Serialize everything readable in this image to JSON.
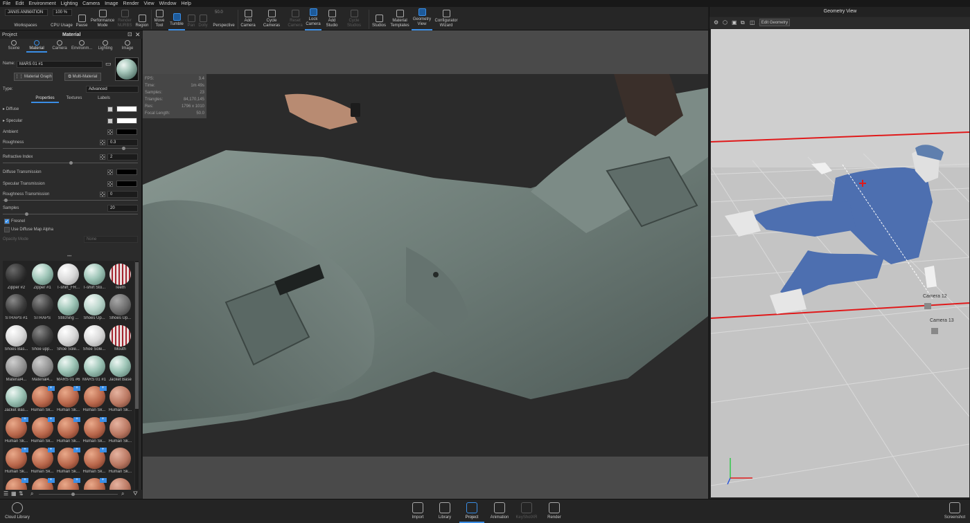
{
  "menu": [
    "File",
    "Edit",
    "Environment",
    "Lighting",
    "Camera",
    "Image",
    "Render",
    "View",
    "Window",
    "Help"
  ],
  "toolbar": {
    "workspace_name": "JANIS ANIMATION",
    "workspaces_label": "Workspaces",
    "cpu_value": "100 %",
    "cpu_label": "CPU Usage",
    "pause_label": "Pause",
    "performance_label": "Performance Mode",
    "render_nurbs_label": "Render NURBS",
    "region_label": "Region",
    "move_tool_label": "Move Tool",
    "tumble_label": "Tumble",
    "pan_label": "Pan",
    "dolly_label": "Dolly",
    "focal_value": "50.0",
    "perspective_label": "Perspective",
    "add_camera_label": "Add Camera",
    "cycle_cameras_label": "Cycle Cameras",
    "reset_camera_label": "Reset Camera",
    "lock_camera_label": "Lock Camera",
    "add_studio_label": "Add Studio",
    "cycle_studios_label": "Cycle Studios",
    "studios_label": "Studios",
    "material_templates_label": "Material Templates",
    "geometry_view_label": "Geometry View",
    "configurator_label": "Configurator Wizard"
  },
  "left_panel": {
    "project_label": "Project",
    "title": "Material",
    "tabs": [
      "Scene",
      "Material",
      "Camera",
      "Environm...",
      "Lighting",
      "Image"
    ],
    "name_label": "Name:",
    "name_value": "MARS 01 #1",
    "material_graph_label": "Material Graph",
    "multi_material_label": "Multi-Material",
    "type_label": "Type:",
    "type_value": "Advanced",
    "prop_tabs": [
      "Properties",
      "Textures",
      "Labels"
    ],
    "props": {
      "diffuse": "Diffuse",
      "specular": "Specular",
      "ambient": "Ambient",
      "roughness": "Roughness",
      "roughness_value": "0.3",
      "refractive_index": "Refractive Index",
      "refractive_value": "2",
      "diffuse_transmission": "Diffuse Transmission",
      "specular_transmission": "Specular Transmission",
      "roughness_transmission": "Roughness Transmission",
      "roughness_transmission_value": "0",
      "samples": "Samples",
      "samples_value": "20",
      "fresnel": "Fresnel",
      "use_diffuse_alpha": "Use Diffuse Map Alpha",
      "opacity_mode": "Opacity Mode",
      "opacity_value": "None"
    },
    "more_dots": "•••",
    "materials": [
      {
        "name": "Zipper #2",
        "kind": "dark"
      },
      {
        "name": "Zipper #1",
        "kind": "mint"
      },
      {
        "name": "T-shirt_FR...",
        "kind": "white"
      },
      {
        "name": "T-shirt Sto...",
        "kind": "mint"
      },
      {
        "name": "Teeth",
        "kind": "teeth"
      },
      {
        "name": "STRAPS #1",
        "kind": "darktex"
      },
      {
        "name": "STRAPS",
        "kind": "darktex"
      },
      {
        "name": "Stitching ...",
        "kind": "mint"
      },
      {
        "name": "Shoes Up...",
        "kind": "mintlight"
      },
      {
        "name": "Shoes Up...",
        "kind": "greytex"
      },
      {
        "name": "Shoes Bas...",
        "kind": "white"
      },
      {
        "name": "Shoe upp...",
        "kind": "darktex"
      },
      {
        "name": "Shoe Sole...",
        "kind": "white"
      },
      {
        "name": "Shoe Sole...",
        "kind": "white"
      },
      {
        "name": "Mouth",
        "kind": "teeth"
      },
      {
        "name": "Material4...",
        "kind": "grey"
      },
      {
        "name": "Material4...",
        "kind": "grey"
      },
      {
        "name": "MARS 01 #6",
        "kind": "mint"
      },
      {
        "name": "MARS 01 #1",
        "kind": "mint"
      },
      {
        "name": "Jacket Base",
        "kind": "mint"
      },
      {
        "name": "Jacket Bas...",
        "kind": "mint"
      },
      {
        "name": "Human Sk...",
        "kind": "skin"
      },
      {
        "name": "Human Sk...",
        "kind": "skin"
      },
      {
        "name": "Human Sk...",
        "kind": "skin"
      },
      {
        "name": "Human Sk...",
        "kind": "skinplain"
      },
      {
        "name": "Human Sk...",
        "kind": "skin"
      },
      {
        "name": "Human Sk...",
        "kind": "skin"
      },
      {
        "name": "Human Sk...",
        "kind": "skin"
      },
      {
        "name": "Human Sk...",
        "kind": "skin"
      },
      {
        "name": "Human Sk...",
        "kind": "skinplain"
      },
      {
        "name": "Human Sk...",
        "kind": "skin"
      },
      {
        "name": "Human Sk...",
        "kind": "skin"
      },
      {
        "name": "Human Sk...",
        "kind": "skin"
      },
      {
        "name": "Human Sk...",
        "kind": "skin"
      },
      {
        "name": "Human Sk...",
        "kind": "skinplain"
      },
      {
        "name": "",
        "kind": "skin"
      },
      {
        "name": "",
        "kind": "skin"
      },
      {
        "name": "",
        "kind": "skin"
      },
      {
        "name": "",
        "kind": "skin"
      },
      {
        "name": "",
        "kind": "skinplain"
      }
    ]
  },
  "stats": [
    {
      "k": "FPS:",
      "v": "3.4"
    },
    {
      "k": "Time:",
      "v": "1m 49s"
    },
    {
      "k": "Samples:",
      "v": "23"
    },
    {
      "k": "Triangles:",
      "v": "84,170,145"
    },
    {
      "k": "Res:",
      "v": "1796 x 1010"
    },
    {
      "k": "Focal Length:",
      "v": "50.0"
    }
  ],
  "geometry_view": {
    "title": "Geometry View",
    "edit_label": "Edit Geometry",
    "camera_labels": [
      "Camera 12",
      "Camera 13"
    ]
  },
  "bottom": {
    "cloud_library": "Cloud Library",
    "items": [
      {
        "label": "Import",
        "state": "normal"
      },
      {
        "label": "Library",
        "state": "normal"
      },
      {
        "label": "Project",
        "state": "selected"
      },
      {
        "label": "Animation",
        "state": "normal"
      },
      {
        "label": "KeyShotXR",
        "state": "dim"
      },
      {
        "label": "Render",
        "state": "normal"
      }
    ],
    "screenshot": "Screenshot"
  },
  "colors": {
    "accent": "#3a8ee6",
    "jacket": "#6f7e79",
    "figure_blue": "#4d6fb0",
    "red_line": "#e0191a"
  }
}
